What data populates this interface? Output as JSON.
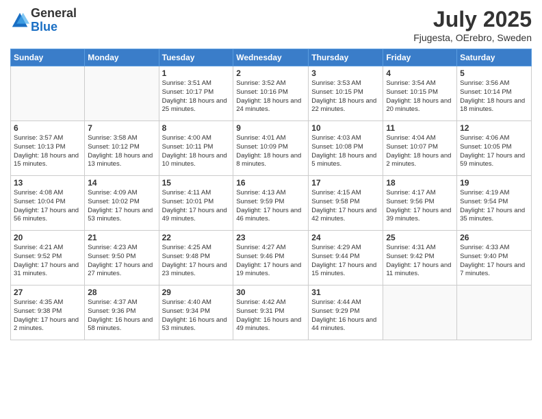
{
  "header": {
    "logo_line1": "General",
    "logo_line2": "Blue",
    "month_title": "July 2025",
    "location": "Fjugesta, OErebro, Sweden"
  },
  "days_of_week": [
    "Sunday",
    "Monday",
    "Tuesday",
    "Wednesday",
    "Thursday",
    "Friday",
    "Saturday"
  ],
  "weeks": [
    [
      {
        "day": "",
        "content": ""
      },
      {
        "day": "",
        "content": ""
      },
      {
        "day": "1",
        "content": "Sunrise: 3:51 AM\nSunset: 10:17 PM\nDaylight: 18 hours\nand 25 minutes."
      },
      {
        "day": "2",
        "content": "Sunrise: 3:52 AM\nSunset: 10:16 PM\nDaylight: 18 hours\nand 24 minutes."
      },
      {
        "day": "3",
        "content": "Sunrise: 3:53 AM\nSunset: 10:15 PM\nDaylight: 18 hours\nand 22 minutes."
      },
      {
        "day": "4",
        "content": "Sunrise: 3:54 AM\nSunset: 10:15 PM\nDaylight: 18 hours\nand 20 minutes."
      },
      {
        "day": "5",
        "content": "Sunrise: 3:56 AM\nSunset: 10:14 PM\nDaylight: 18 hours\nand 18 minutes."
      }
    ],
    [
      {
        "day": "6",
        "content": "Sunrise: 3:57 AM\nSunset: 10:13 PM\nDaylight: 18 hours\nand 15 minutes."
      },
      {
        "day": "7",
        "content": "Sunrise: 3:58 AM\nSunset: 10:12 PM\nDaylight: 18 hours\nand 13 minutes."
      },
      {
        "day": "8",
        "content": "Sunrise: 4:00 AM\nSunset: 10:11 PM\nDaylight: 18 hours\nand 10 minutes."
      },
      {
        "day": "9",
        "content": "Sunrise: 4:01 AM\nSunset: 10:09 PM\nDaylight: 18 hours\nand 8 minutes."
      },
      {
        "day": "10",
        "content": "Sunrise: 4:03 AM\nSunset: 10:08 PM\nDaylight: 18 hours\nand 5 minutes."
      },
      {
        "day": "11",
        "content": "Sunrise: 4:04 AM\nSunset: 10:07 PM\nDaylight: 18 hours\nand 2 minutes."
      },
      {
        "day": "12",
        "content": "Sunrise: 4:06 AM\nSunset: 10:05 PM\nDaylight: 17 hours\nand 59 minutes."
      }
    ],
    [
      {
        "day": "13",
        "content": "Sunrise: 4:08 AM\nSunset: 10:04 PM\nDaylight: 17 hours\nand 56 minutes."
      },
      {
        "day": "14",
        "content": "Sunrise: 4:09 AM\nSunset: 10:02 PM\nDaylight: 17 hours\nand 53 minutes."
      },
      {
        "day": "15",
        "content": "Sunrise: 4:11 AM\nSunset: 10:01 PM\nDaylight: 17 hours\nand 49 minutes."
      },
      {
        "day": "16",
        "content": "Sunrise: 4:13 AM\nSunset: 9:59 PM\nDaylight: 17 hours\nand 46 minutes."
      },
      {
        "day": "17",
        "content": "Sunrise: 4:15 AM\nSunset: 9:58 PM\nDaylight: 17 hours\nand 42 minutes."
      },
      {
        "day": "18",
        "content": "Sunrise: 4:17 AM\nSunset: 9:56 PM\nDaylight: 17 hours\nand 39 minutes."
      },
      {
        "day": "19",
        "content": "Sunrise: 4:19 AM\nSunset: 9:54 PM\nDaylight: 17 hours\nand 35 minutes."
      }
    ],
    [
      {
        "day": "20",
        "content": "Sunrise: 4:21 AM\nSunset: 9:52 PM\nDaylight: 17 hours\nand 31 minutes."
      },
      {
        "day": "21",
        "content": "Sunrise: 4:23 AM\nSunset: 9:50 PM\nDaylight: 17 hours\nand 27 minutes."
      },
      {
        "day": "22",
        "content": "Sunrise: 4:25 AM\nSunset: 9:48 PM\nDaylight: 17 hours\nand 23 minutes."
      },
      {
        "day": "23",
        "content": "Sunrise: 4:27 AM\nSunset: 9:46 PM\nDaylight: 17 hours\nand 19 minutes."
      },
      {
        "day": "24",
        "content": "Sunrise: 4:29 AM\nSunset: 9:44 PM\nDaylight: 17 hours\nand 15 minutes."
      },
      {
        "day": "25",
        "content": "Sunrise: 4:31 AM\nSunset: 9:42 PM\nDaylight: 17 hours\nand 11 minutes."
      },
      {
        "day": "26",
        "content": "Sunrise: 4:33 AM\nSunset: 9:40 PM\nDaylight: 17 hours\nand 7 minutes."
      }
    ],
    [
      {
        "day": "27",
        "content": "Sunrise: 4:35 AM\nSunset: 9:38 PM\nDaylight: 17 hours\nand 2 minutes."
      },
      {
        "day": "28",
        "content": "Sunrise: 4:37 AM\nSunset: 9:36 PM\nDaylight: 16 hours\nand 58 minutes."
      },
      {
        "day": "29",
        "content": "Sunrise: 4:40 AM\nSunset: 9:34 PM\nDaylight: 16 hours\nand 53 minutes."
      },
      {
        "day": "30",
        "content": "Sunrise: 4:42 AM\nSunset: 9:31 PM\nDaylight: 16 hours\nand 49 minutes."
      },
      {
        "day": "31",
        "content": "Sunrise: 4:44 AM\nSunset: 9:29 PM\nDaylight: 16 hours\nand 44 minutes."
      },
      {
        "day": "",
        "content": ""
      },
      {
        "day": "",
        "content": ""
      }
    ]
  ]
}
